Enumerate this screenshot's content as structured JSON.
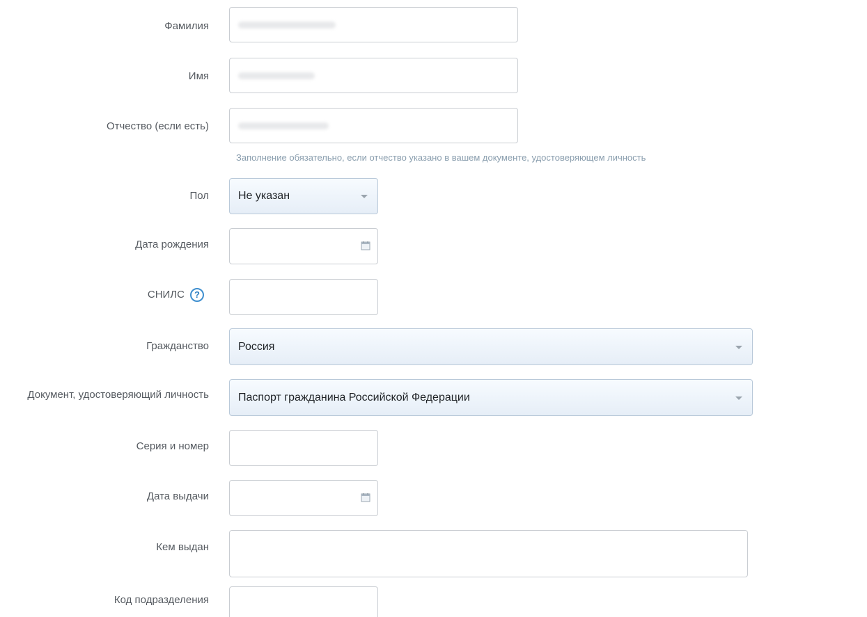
{
  "form": {
    "labels": {
      "last_name": "Фамилия",
      "first_name": "Имя",
      "patronymic": "Отчество (если есть)",
      "gender": "Пол",
      "birth_date": "Дата рождения",
      "snils": "СНИЛС",
      "citizenship": "Гражданство",
      "identity_document": "Документ, удостоверяющий личность",
      "series_number": "Серия и номер",
      "issue_date": "Дата выдачи",
      "issued_by": "Кем выдан",
      "division_code": "Код подразделения"
    },
    "patronymic_hint": "Заполнение обязательно, если отчество указано в вашем документе, удостоверяющем личность",
    "gender_value": "Не указан",
    "citizenship_value": "Россия",
    "identity_document_value": "Паспорт гражданина Российской Федерации",
    "snils_help_icon": "question-circle-icon",
    "snils_help_glyph": "?",
    "calendar_icon": "calendar-icon",
    "colors": {
      "label": "#555a60",
      "hint": "#8a9eae",
      "help_accent": "#3f8fcf",
      "field_border": "#c9cdd2"
    }
  }
}
